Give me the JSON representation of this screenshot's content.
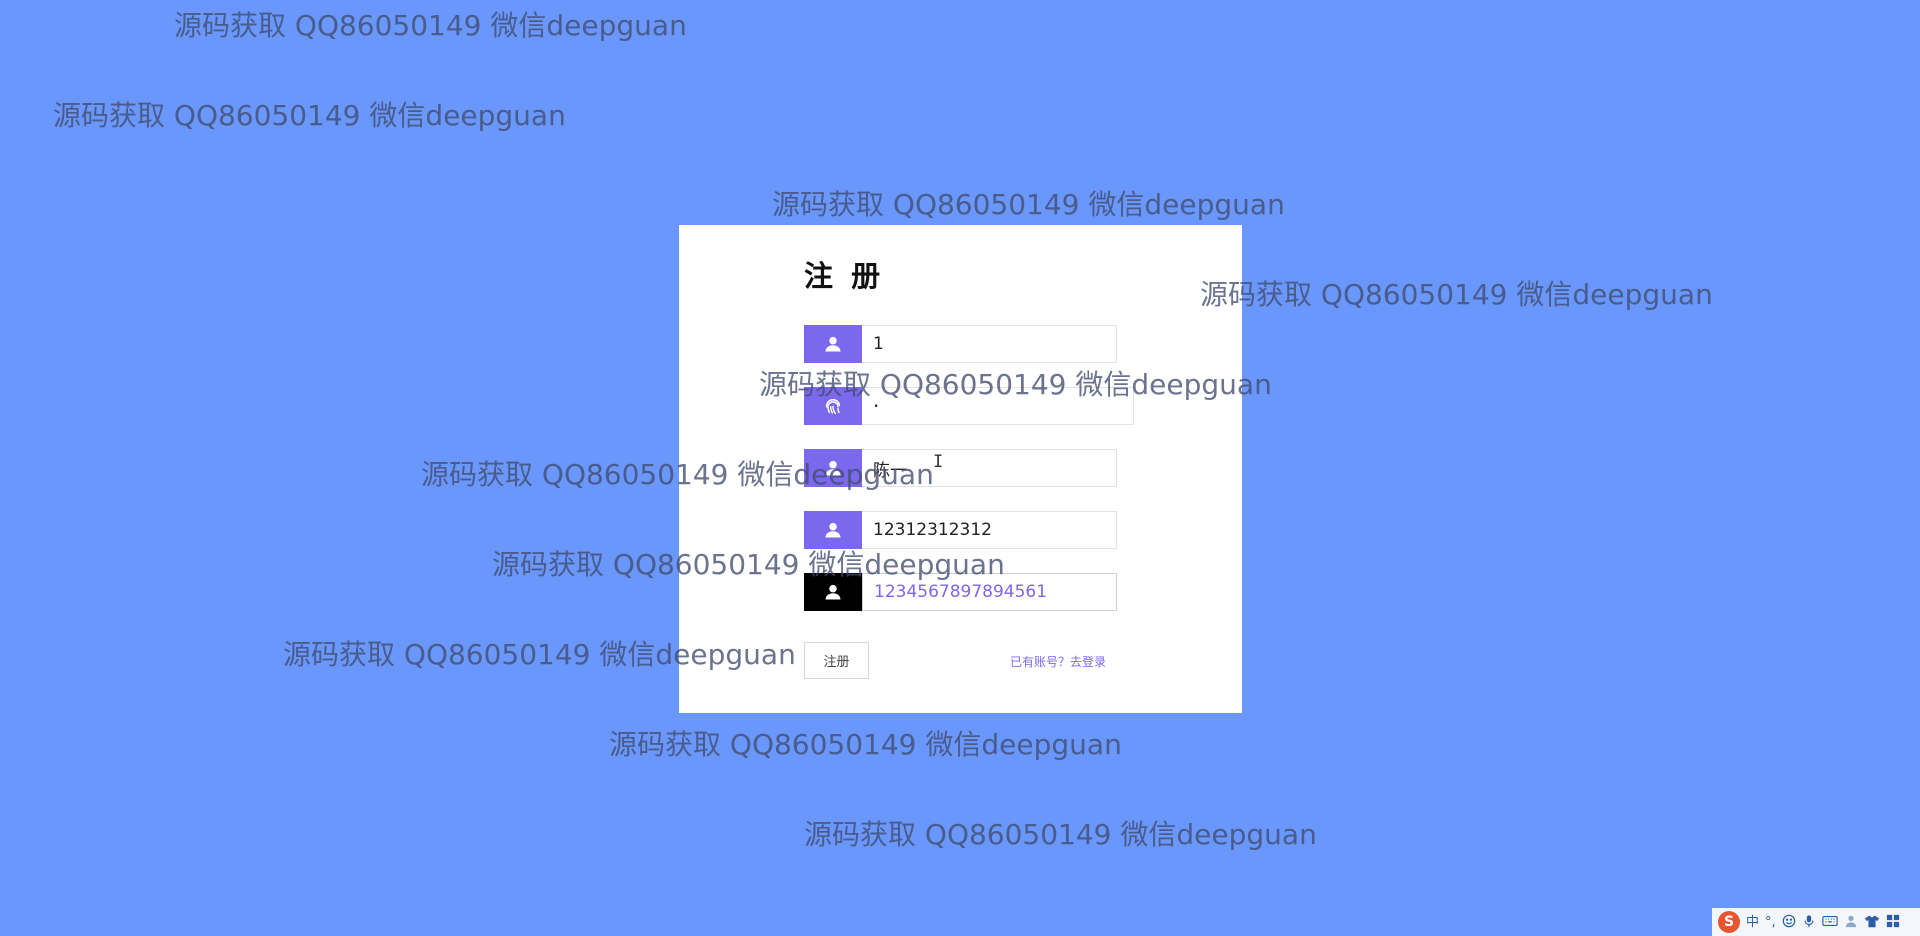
{
  "form": {
    "title": "注 册",
    "fields": [
      {
        "value": "1",
        "icon": "user-icon",
        "type": "text"
      },
      {
        "value": "·",
        "icon": "fingerprint-icon",
        "type": "password"
      },
      {
        "value": "陈一",
        "icon": "user-icon",
        "type": "text"
      },
      {
        "value": "12312312312",
        "icon": "user-icon",
        "type": "text"
      },
      {
        "value": "1234567897894561",
        "icon": "user-icon",
        "type": "text",
        "focused": true
      }
    ],
    "register_label": "注册",
    "login_link": "已有账号？去登录"
  },
  "watermark": {
    "text": "源码获取 QQ86050149 微信deepguan"
  },
  "tray": {
    "ime_logo": "S",
    "ime_mode": "中",
    "punctuation": "°,",
    "items": [
      "emoji-icon",
      "microphone-icon",
      "keyboard-icon",
      "user-icon",
      "shirt-icon",
      "grid-icon"
    ]
  },
  "colors": {
    "background": "#6a97fb",
    "accent": "#7b68ee",
    "active_icon_bg": "#000000",
    "card": "#ffffff"
  }
}
